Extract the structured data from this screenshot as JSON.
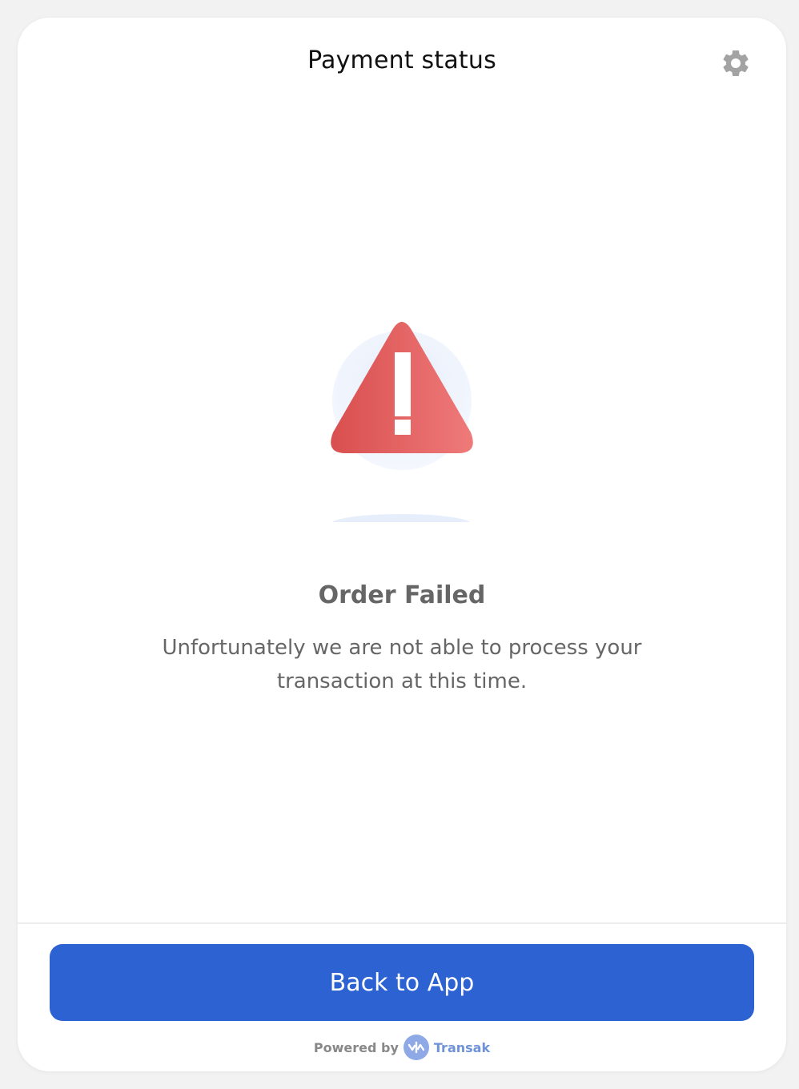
{
  "header": {
    "title": "Payment status",
    "settings_icon": "gear-icon"
  },
  "status": {
    "icon": "warning-triangle-icon",
    "title": "Order Failed",
    "message": "Unfortunately we are not able to process your transaction at this time."
  },
  "footer": {
    "primary_button_label": "Back to App",
    "powered_by_label": "Powered by",
    "brand_name": "Transak",
    "brand_icon": "transak-logo-icon"
  },
  "colors": {
    "primary": "#2d62d3",
    "error": "#e05252",
    "muted_text": "#666666",
    "brand": "#6f92d8"
  }
}
